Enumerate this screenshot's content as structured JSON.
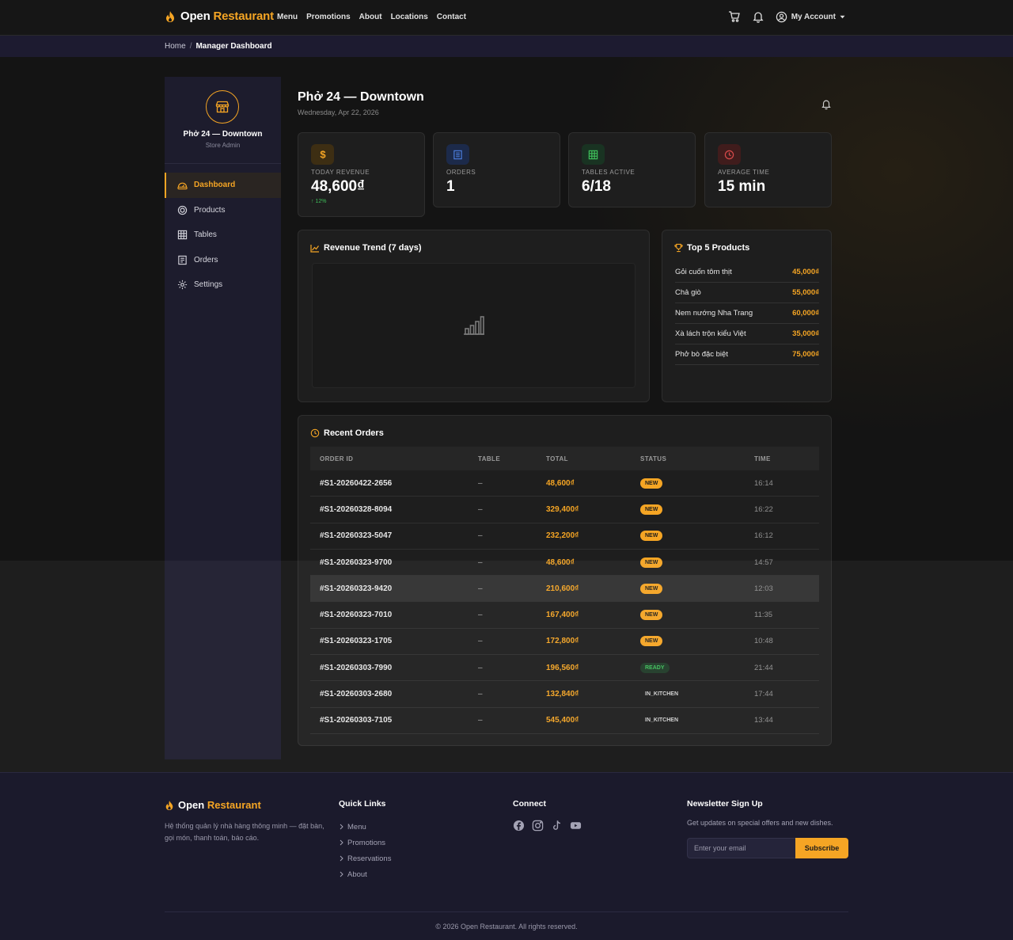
{
  "navbar": {
    "brand_main": "Open",
    "brand_accent": "Restaurant",
    "links": [
      "Menu",
      "Promotions",
      "About",
      "Locations",
      "Contact"
    ],
    "account_label": "My Account"
  },
  "breadcrumb": {
    "home": "Home",
    "separator": "/",
    "current": "Manager Dashboard"
  },
  "sidebar": {
    "store_name": "Phở 24 — Downtown",
    "store_role": "Store Admin",
    "items": [
      {
        "label": "Dashboard",
        "icon": "gauge-icon",
        "active": true
      },
      {
        "label": "Products",
        "icon": "box-icon",
        "active": false
      },
      {
        "label": "Tables",
        "icon": "grid-icon",
        "active": false
      },
      {
        "label": "Orders",
        "icon": "receipt-icon",
        "active": false
      },
      {
        "label": "Settings",
        "icon": "gear-icon",
        "active": false
      }
    ]
  },
  "header": {
    "title": "Phở 24 — Downtown",
    "date": "Wednesday, Apr 22, 2026"
  },
  "stats": [
    {
      "label": "TODAY REVENUE",
      "value": "48,600₫",
      "delta": "↑ 12%",
      "icon": "dollar-icon",
      "color": "#f5a524"
    },
    {
      "label": "ORDERS",
      "value": "1",
      "delta": "",
      "icon": "receipt-icon",
      "color": "#4a7bd8"
    },
    {
      "label": "TABLES ACTIVE",
      "value": "6/18",
      "delta": "",
      "icon": "grid-icon",
      "color": "#3fbf5a"
    },
    {
      "label": "AVERAGE TIME",
      "value": "15 min",
      "delta": "",
      "icon": "clock-icon",
      "color": "#d84a4a"
    }
  ],
  "revenue_trend": {
    "title": "Revenue Trend (7 days)"
  },
  "top_products": {
    "title": "Top 5 Products",
    "items": [
      {
        "name": "Gỏi cuốn tôm thịt",
        "price": "45,000₫"
      },
      {
        "name": "Chả giò",
        "price": "55,000₫"
      },
      {
        "name": "Nem nướng Nha Trang",
        "price": "60,000₫"
      },
      {
        "name": "Xà lách trộn kiểu Việt",
        "price": "35,000₫"
      },
      {
        "name": "Phở bò đặc biệt",
        "price": "75,000₫"
      }
    ]
  },
  "recent_orders": {
    "title": "Recent Orders",
    "columns": [
      "ORDER ID",
      "TABLE",
      "TOTAL",
      "STATUS",
      "TIME"
    ],
    "rows": [
      {
        "id": "#S1-20260422-2656",
        "table": "–",
        "total": "48,600₫",
        "status": "NEW",
        "time": "16:14"
      },
      {
        "id": "#S1-20260328-8094",
        "table": "–",
        "total": "329,400₫",
        "status": "NEW",
        "time": "16:22"
      },
      {
        "id": "#S1-20260323-5047",
        "table": "–",
        "total": "232,200₫",
        "status": "NEW",
        "time": "16:12"
      },
      {
        "id": "#S1-20260323-9700",
        "table": "–",
        "total": "48,600₫",
        "status": "NEW",
        "time": "14:57"
      },
      {
        "id": "#S1-20260323-9420",
        "table": "–",
        "total": "210,600₫",
        "status": "NEW",
        "time": "12:03"
      },
      {
        "id": "#S1-20260323-7010",
        "table": "–",
        "total": "167,400₫",
        "status": "NEW",
        "time": "11:35"
      },
      {
        "id": "#S1-20260323-1705",
        "table": "–",
        "total": "172,800₫",
        "status": "NEW",
        "time": "10:48"
      },
      {
        "id": "#S1-20260303-7990",
        "table": "–",
        "total": "196,560₫",
        "status": "READY",
        "time": "21:44"
      },
      {
        "id": "#S1-20260303-2680",
        "table": "–",
        "total": "132,840₫",
        "status": "IN_KITCHEN",
        "time": "17:44"
      },
      {
        "id": "#S1-20260303-7105",
        "table": "–",
        "total": "545,400₫",
        "status": "IN_KITCHEN",
        "time": "13:44"
      }
    ]
  },
  "footer": {
    "brand_main": "Open",
    "brand_accent": "Restaurant",
    "description": "Hệ thống quản lý nhà hàng thông minh — đặt bàn, gọi món, thanh toán, báo cáo.",
    "quick_links_title": "Quick Links",
    "quick_links": [
      "Menu",
      "Promotions",
      "Reservations",
      "About"
    ],
    "connect_title": "Connect",
    "socials": [
      "facebook-icon",
      "instagram-icon",
      "tiktok-icon",
      "youtube-icon"
    ],
    "newsletter_title": "Newsletter Sign Up",
    "newsletter_desc": "Get updates on special offers and new dishes.",
    "email_placeholder": "Enter your email",
    "subscribe_label": "Subscribe",
    "copyright": "© 2026 Open Restaurant. All rights reserved."
  },
  "colors": {
    "accent": "#f5a524",
    "background": "#141414",
    "sidebar": "#1d1c2d",
    "footer": "#1b1a2c"
  }
}
